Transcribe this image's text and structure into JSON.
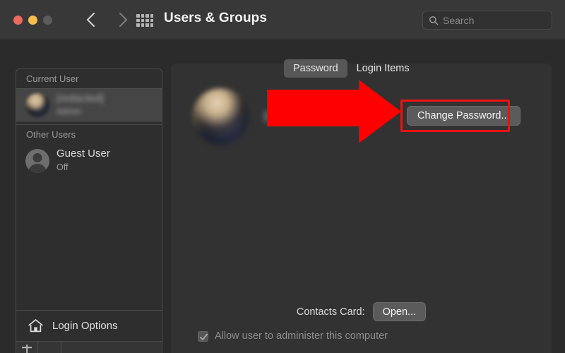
{
  "window": {
    "title": "Users & Groups",
    "traffic_lights": [
      {
        "name": "close",
        "color": "#ed6a5e"
      },
      {
        "name": "minimize",
        "color": "#f5bd4f"
      },
      {
        "name": "zoom",
        "color": "#5c5c5c"
      }
    ]
  },
  "toolbar": {
    "back_icon": "chevron-left-icon",
    "forward_icon": "chevron-right-icon",
    "grid_icon": "show-all-grid-icon",
    "search": {
      "icon": "search-icon",
      "placeholder": "Search",
      "value": ""
    }
  },
  "sidebar": {
    "groups": [
      {
        "header": "Current User",
        "users": [
          {
            "name": "[redacted]",
            "sub": "Admin",
            "avatar": "user-photo-avatar",
            "selected": true,
            "blurred": true
          }
        ]
      },
      {
        "header": "Other Users",
        "users": [
          {
            "name": "Guest User",
            "sub": "Off",
            "avatar": "default-person-avatar",
            "selected": false,
            "blurred": false
          }
        ]
      }
    ],
    "login_options": {
      "label": "Login Options",
      "icon": "home-icon"
    },
    "footer": {
      "add_label": "+",
      "remove_label": "-"
    }
  },
  "main": {
    "tabs": [
      {
        "label": "Password",
        "active": true
      },
      {
        "label": "Login Items",
        "active": false
      }
    ],
    "account": {
      "avatar": "user-photo-avatar-large",
      "name": "[redacted]"
    },
    "change_password_button": "Change Password...",
    "contacts_card": {
      "label": "Contacts Card:",
      "button": "Open..."
    },
    "administer": {
      "label": "Allow user to administer this computer",
      "checked": true,
      "enabled": false
    }
  },
  "annotation": {
    "arrow": "red-right-arrow",
    "arrow_color": "#ff0000",
    "highlight_color": "#ee1111",
    "highlight_target": "Change Password..."
  }
}
